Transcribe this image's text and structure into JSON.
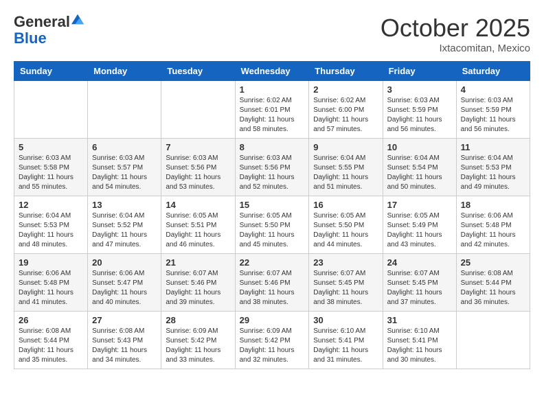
{
  "header": {
    "logo_general": "General",
    "logo_blue": "Blue",
    "month": "October 2025",
    "location": "Ixtacomitan, Mexico"
  },
  "days_of_week": [
    "Sunday",
    "Monday",
    "Tuesday",
    "Wednesday",
    "Thursday",
    "Friday",
    "Saturday"
  ],
  "weeks": [
    [
      {
        "day": "",
        "sunrise": "",
        "sunset": "",
        "daylight": ""
      },
      {
        "day": "",
        "sunrise": "",
        "sunset": "",
        "daylight": ""
      },
      {
        "day": "",
        "sunrise": "",
        "sunset": "",
        "daylight": ""
      },
      {
        "day": "1",
        "sunrise": "Sunrise: 6:02 AM",
        "sunset": "Sunset: 6:01 PM",
        "daylight": "Daylight: 11 hours and 58 minutes."
      },
      {
        "day": "2",
        "sunrise": "Sunrise: 6:02 AM",
        "sunset": "Sunset: 6:00 PM",
        "daylight": "Daylight: 11 hours and 57 minutes."
      },
      {
        "day": "3",
        "sunrise": "Sunrise: 6:03 AM",
        "sunset": "Sunset: 5:59 PM",
        "daylight": "Daylight: 11 hours and 56 minutes."
      },
      {
        "day": "4",
        "sunrise": "Sunrise: 6:03 AM",
        "sunset": "Sunset: 5:59 PM",
        "daylight": "Daylight: 11 hours and 56 minutes."
      }
    ],
    [
      {
        "day": "5",
        "sunrise": "Sunrise: 6:03 AM",
        "sunset": "Sunset: 5:58 PM",
        "daylight": "Daylight: 11 hours and 55 minutes."
      },
      {
        "day": "6",
        "sunrise": "Sunrise: 6:03 AM",
        "sunset": "Sunset: 5:57 PM",
        "daylight": "Daylight: 11 hours and 54 minutes."
      },
      {
        "day": "7",
        "sunrise": "Sunrise: 6:03 AM",
        "sunset": "Sunset: 5:56 PM",
        "daylight": "Daylight: 11 hours and 53 minutes."
      },
      {
        "day": "8",
        "sunrise": "Sunrise: 6:03 AM",
        "sunset": "Sunset: 5:56 PM",
        "daylight": "Daylight: 11 hours and 52 minutes."
      },
      {
        "day": "9",
        "sunrise": "Sunrise: 6:04 AM",
        "sunset": "Sunset: 5:55 PM",
        "daylight": "Daylight: 11 hours and 51 minutes."
      },
      {
        "day": "10",
        "sunrise": "Sunrise: 6:04 AM",
        "sunset": "Sunset: 5:54 PM",
        "daylight": "Daylight: 11 hours and 50 minutes."
      },
      {
        "day": "11",
        "sunrise": "Sunrise: 6:04 AM",
        "sunset": "Sunset: 5:53 PM",
        "daylight": "Daylight: 11 hours and 49 minutes."
      }
    ],
    [
      {
        "day": "12",
        "sunrise": "Sunrise: 6:04 AM",
        "sunset": "Sunset: 5:53 PM",
        "daylight": "Daylight: 11 hours and 48 minutes."
      },
      {
        "day": "13",
        "sunrise": "Sunrise: 6:04 AM",
        "sunset": "Sunset: 5:52 PM",
        "daylight": "Daylight: 11 hours and 47 minutes."
      },
      {
        "day": "14",
        "sunrise": "Sunrise: 6:05 AM",
        "sunset": "Sunset: 5:51 PM",
        "daylight": "Daylight: 11 hours and 46 minutes."
      },
      {
        "day": "15",
        "sunrise": "Sunrise: 6:05 AM",
        "sunset": "Sunset: 5:50 PM",
        "daylight": "Daylight: 11 hours and 45 minutes."
      },
      {
        "day": "16",
        "sunrise": "Sunrise: 6:05 AM",
        "sunset": "Sunset: 5:50 PM",
        "daylight": "Daylight: 11 hours and 44 minutes."
      },
      {
        "day": "17",
        "sunrise": "Sunrise: 6:05 AM",
        "sunset": "Sunset: 5:49 PM",
        "daylight": "Daylight: 11 hours and 43 minutes."
      },
      {
        "day": "18",
        "sunrise": "Sunrise: 6:06 AM",
        "sunset": "Sunset: 5:48 PM",
        "daylight": "Daylight: 11 hours and 42 minutes."
      }
    ],
    [
      {
        "day": "19",
        "sunrise": "Sunrise: 6:06 AM",
        "sunset": "Sunset: 5:48 PM",
        "daylight": "Daylight: 11 hours and 41 minutes."
      },
      {
        "day": "20",
        "sunrise": "Sunrise: 6:06 AM",
        "sunset": "Sunset: 5:47 PM",
        "daylight": "Daylight: 11 hours and 40 minutes."
      },
      {
        "day": "21",
        "sunrise": "Sunrise: 6:07 AM",
        "sunset": "Sunset: 5:46 PM",
        "daylight": "Daylight: 11 hours and 39 minutes."
      },
      {
        "day": "22",
        "sunrise": "Sunrise: 6:07 AM",
        "sunset": "Sunset: 5:46 PM",
        "daylight": "Daylight: 11 hours and 38 minutes."
      },
      {
        "day": "23",
        "sunrise": "Sunrise: 6:07 AM",
        "sunset": "Sunset: 5:45 PM",
        "daylight": "Daylight: 11 hours and 38 minutes."
      },
      {
        "day": "24",
        "sunrise": "Sunrise: 6:07 AM",
        "sunset": "Sunset: 5:45 PM",
        "daylight": "Daylight: 11 hours and 37 minutes."
      },
      {
        "day": "25",
        "sunrise": "Sunrise: 6:08 AM",
        "sunset": "Sunset: 5:44 PM",
        "daylight": "Daylight: 11 hours and 36 minutes."
      }
    ],
    [
      {
        "day": "26",
        "sunrise": "Sunrise: 6:08 AM",
        "sunset": "Sunset: 5:44 PM",
        "daylight": "Daylight: 11 hours and 35 minutes."
      },
      {
        "day": "27",
        "sunrise": "Sunrise: 6:08 AM",
        "sunset": "Sunset: 5:43 PM",
        "daylight": "Daylight: 11 hours and 34 minutes."
      },
      {
        "day": "28",
        "sunrise": "Sunrise: 6:09 AM",
        "sunset": "Sunset: 5:42 PM",
        "daylight": "Daylight: 11 hours and 33 minutes."
      },
      {
        "day": "29",
        "sunrise": "Sunrise: 6:09 AM",
        "sunset": "Sunset: 5:42 PM",
        "daylight": "Daylight: 11 hours and 32 minutes."
      },
      {
        "day": "30",
        "sunrise": "Sunrise: 6:10 AM",
        "sunset": "Sunset: 5:41 PM",
        "daylight": "Daylight: 11 hours and 31 minutes."
      },
      {
        "day": "31",
        "sunrise": "Sunrise: 6:10 AM",
        "sunset": "Sunset: 5:41 PM",
        "daylight": "Daylight: 11 hours and 30 minutes."
      },
      {
        "day": "",
        "sunrise": "",
        "sunset": "",
        "daylight": ""
      }
    ]
  ]
}
